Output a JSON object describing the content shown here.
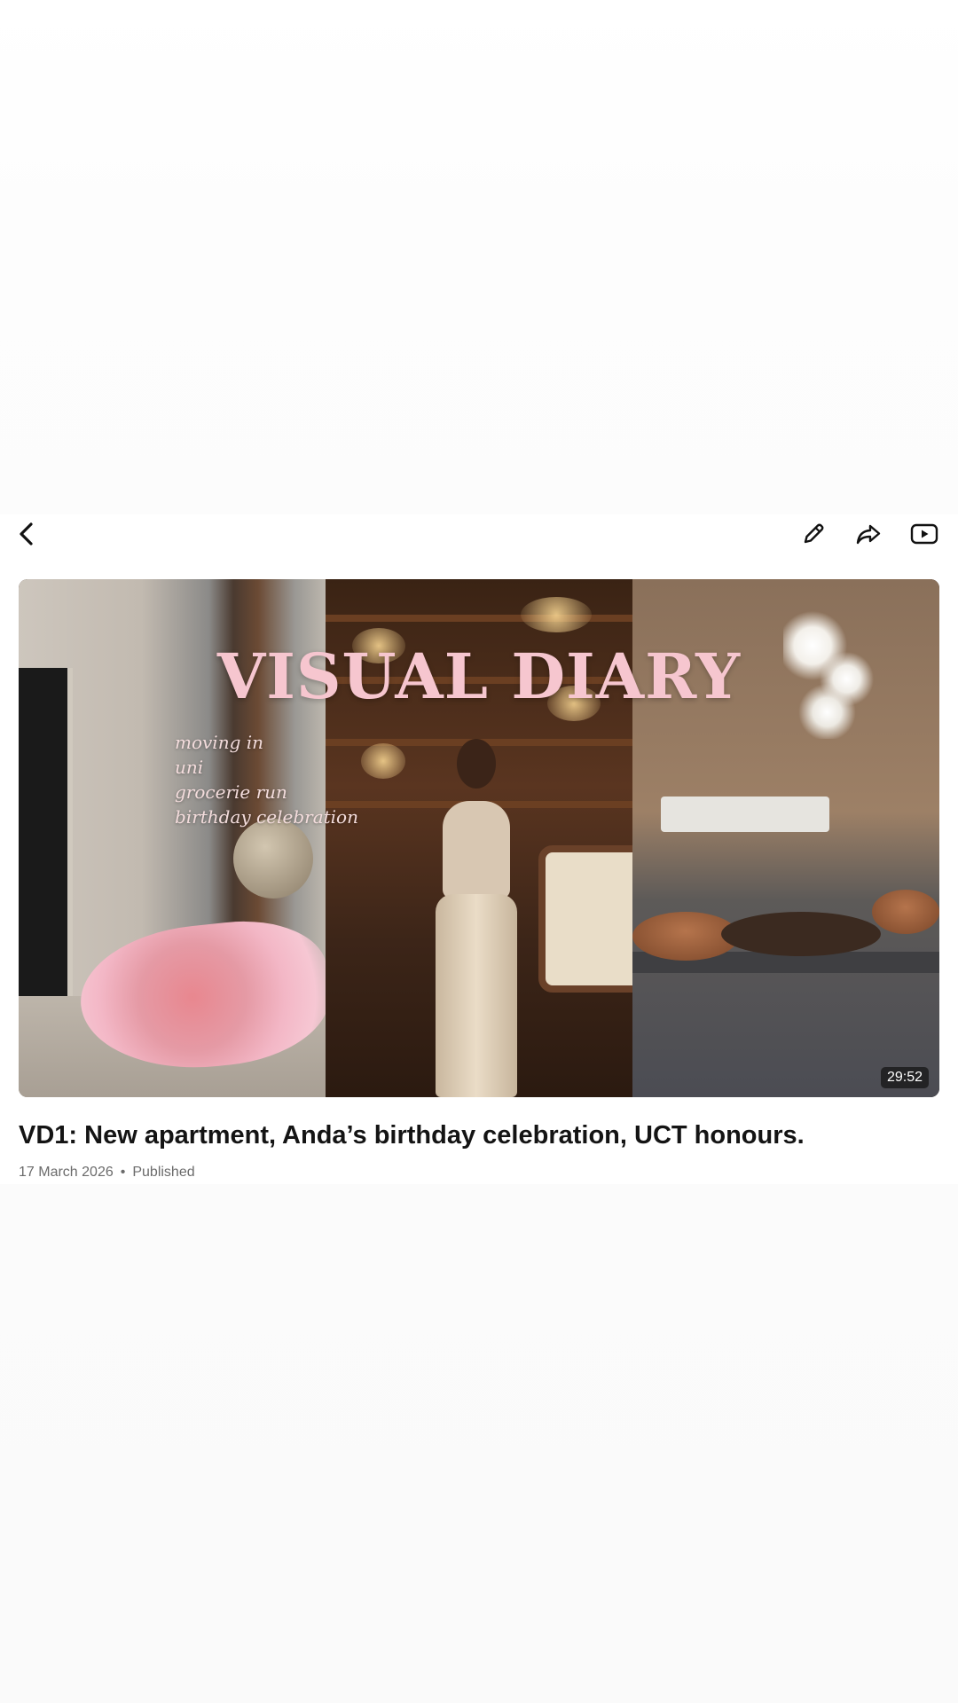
{
  "header": {
    "icons": {
      "back": "back-chevron-icon",
      "edit": "pencil-icon",
      "share": "share-arrow-icon",
      "youtube": "youtube-icon"
    }
  },
  "video": {
    "thumbnail": {
      "overlay_title": "VISUAL DIARY",
      "overlay_items": [
        "moving in",
        "uni",
        "grocerie run",
        "birthday celebration"
      ],
      "duration": "29:52"
    },
    "title": "VD1: New apartment, Anda’s birthday celebration, UCT honours.",
    "date": "17 March 2026",
    "separator": "•",
    "status": "Published"
  }
}
